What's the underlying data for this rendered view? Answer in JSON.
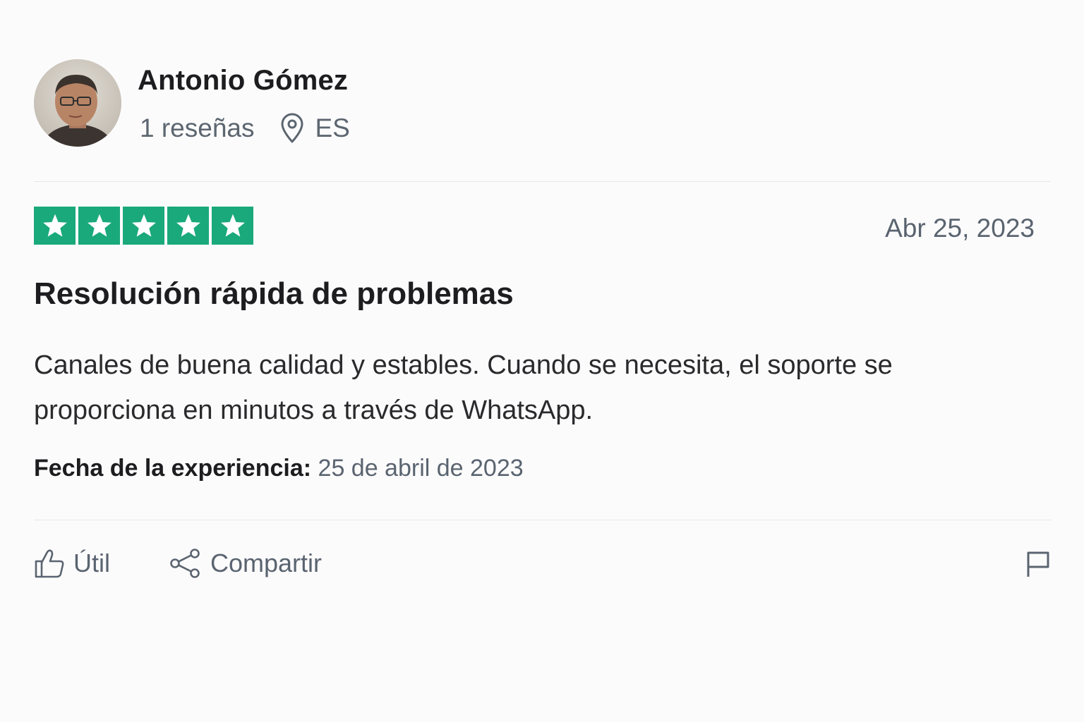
{
  "reviewer": {
    "name": "Antonio Gómez",
    "review_count": "1 reseñas",
    "country": "ES"
  },
  "review": {
    "rating": 5,
    "rating_max": 5,
    "star_color": "#1aa97a",
    "date": "Abr 25, 2023",
    "title": "Resolución rápida de problemas",
    "body": "Canales de buena calidad y estables. Cuando se necesita, el soporte se proporciona en minutos a través de WhatsApp.",
    "experience_label": "Fecha de la experiencia:",
    "experience_value": "25 de abril de 2023"
  },
  "actions": {
    "useful_label": "Útil",
    "share_label": "Compartir"
  },
  "icons": {
    "location": "location-pin-icon",
    "useful": "thumbs-up-icon",
    "share": "share-icon",
    "flag": "flag-icon"
  }
}
